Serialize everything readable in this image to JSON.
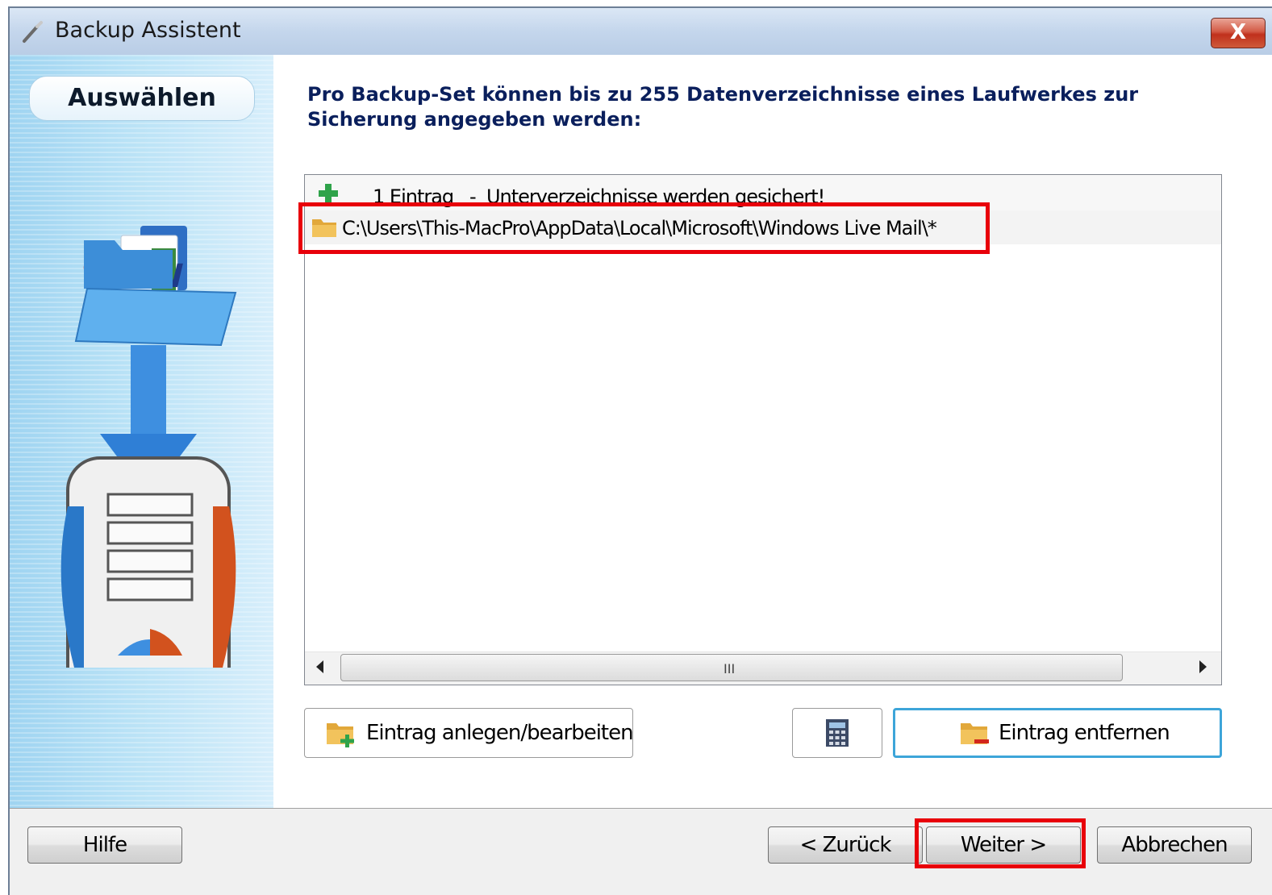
{
  "window": {
    "title": "Backup Assistent",
    "close_label": "X"
  },
  "sidebar": {
    "step_label": "Auswählen"
  },
  "main": {
    "heading_line1": "Pro Backup-Set können bis zu 255 Datenverzeichnisse eines Laufwerkes zur",
    "heading_line2": "Sicherung angegeben werden:"
  },
  "list": {
    "header": "1 Eintrag   -  Unterverzeichnisse werden gesichert!",
    "rows": [
      {
        "path": "C:\\Users\\This-MacPro\\AppData\\Local\\Microsoft\\Windows Live Mail\\*"
      }
    ],
    "scroll_grip": "III"
  },
  "actions": {
    "add_edit_label": "Eintrag anlegen/bearbeiten",
    "remove_label": "Eintrag entfernen"
  },
  "footer": {
    "help_label": "Hilfe",
    "back_label": "< Zurück",
    "next_label": "Weiter >",
    "cancel_label": "Abbrechen"
  },
  "colors": {
    "highlight": "#e8000a",
    "heading": "#0a1f5c",
    "focus_border": "#3da5d9"
  }
}
